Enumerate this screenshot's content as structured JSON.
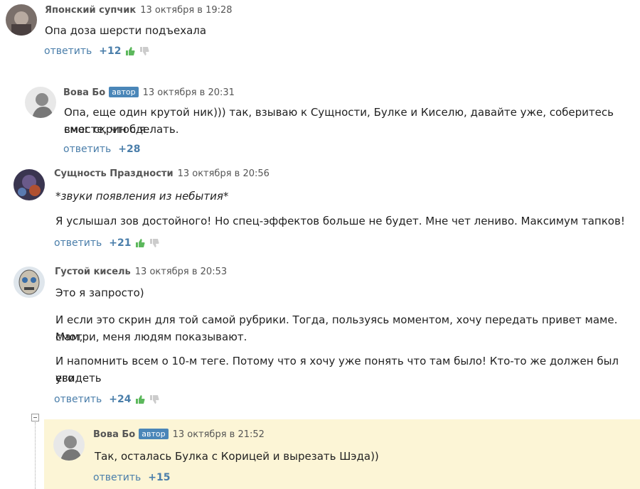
{
  "comments": [
    {
      "author": "Японский супчик",
      "date": "13 октября в 19:28",
      "paragraphs": [
        "Опа доза шерсти подъехала"
      ],
      "reply": "ответить",
      "score": "+12"
    },
    {
      "author": "Вова Бо",
      "badge": "автор",
      "date": "13 октября в 20:31",
      "paragraphs": [
        "Опа, еще один крутой ник))) так, взываю к Сущности, Булке и Киселю, давайте уже, соберитесь вместе, чтоб я",
        "смог скрин сделать."
      ],
      "reply": "ответить",
      "score": "+28"
    },
    {
      "author": "Сущность Праздности",
      "date": "13 октября в 20:56",
      "paragraphs": [
        "*звуки появления из небытия*",
        "Я услышал зов достойного! Но спец-эффектов больше не будет. Мне чет лениво. Максимум тапков!"
      ],
      "reply": "ответить",
      "score": "+21"
    },
    {
      "author": "Густой кисель",
      "date": "13 октября в 20:53",
      "paragraphs": [
        "Это я запросто)",
        "И если это скрин для той самой рубрики. Тогда, пользуясь моментом, хочу передать привет маме. Мам,",
        "смотри, меня людям показывают.",
        "И напомнить всем о 10-м теге. Потому что я хочу уже понять что там было! Кто-то же должен был его",
        "увидеть"
      ],
      "reply": "ответить",
      "score": "+24"
    },
    {
      "author": "Вова Бо",
      "badge": "автор",
      "date": "13 октября в 21:52",
      "paragraphs": [
        "Так, осталась Булка с Корицей и вырезать Шэда))"
      ],
      "reply": "ответить",
      "score": "+15"
    }
  ],
  "colors": {
    "link": "#4a7eaa",
    "badge": "#4a86b8",
    "highlight": "#fcf5d6",
    "thumb_up": "#5cb85c",
    "thumb_down": "#cccccc"
  },
  "icons": {
    "like": "thumbs-up-icon",
    "dislike": "thumbs-down-icon",
    "collapse": "minus-square-icon"
  }
}
